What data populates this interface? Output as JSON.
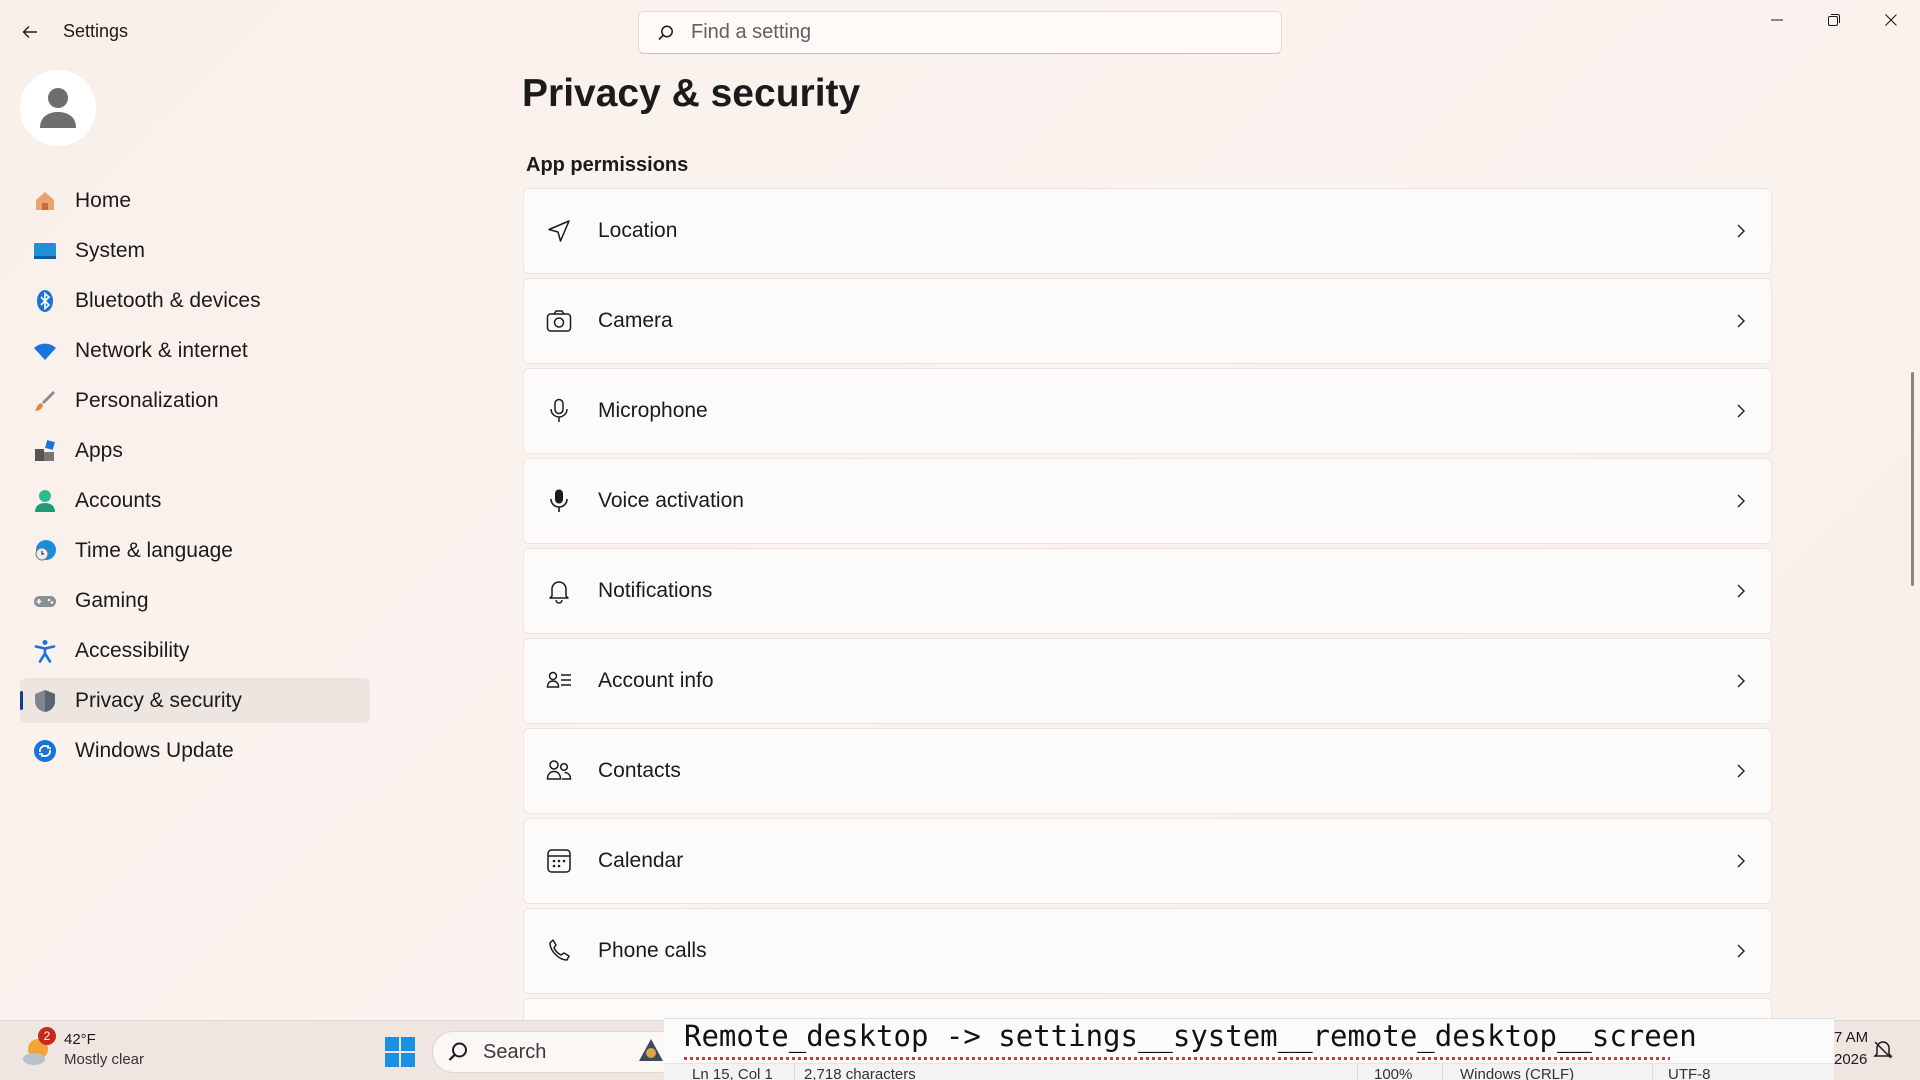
{
  "window": {
    "app_title": "Settings",
    "search_placeholder": "Find a setting"
  },
  "sidebar": {
    "items": [
      {
        "label": "Home",
        "icon": "home-icon"
      },
      {
        "label": "System",
        "icon": "system-icon"
      },
      {
        "label": "Bluetooth & devices",
        "icon": "bluetooth-icon"
      },
      {
        "label": "Network & internet",
        "icon": "wifi-icon"
      },
      {
        "label": "Personalization",
        "icon": "brush-icon"
      },
      {
        "label": "Apps",
        "icon": "apps-icon"
      },
      {
        "label": "Accounts",
        "icon": "person-icon"
      },
      {
        "label": "Time & language",
        "icon": "globe-clock-icon"
      },
      {
        "label": "Gaming",
        "icon": "gamepad-icon"
      },
      {
        "label": "Accessibility",
        "icon": "accessibility-icon"
      },
      {
        "label": "Privacy & security",
        "icon": "shield-icon",
        "active": true
      },
      {
        "label": "Windows Update",
        "icon": "update-icon"
      }
    ]
  },
  "main": {
    "page_title": "Privacy & security",
    "section_title": "App permissions",
    "permissions": [
      {
        "label": "Location",
        "icon": "location-icon"
      },
      {
        "label": "Camera",
        "icon": "camera-icon"
      },
      {
        "label": "Microphone",
        "icon": "microphone-icon"
      },
      {
        "label": "Voice activation",
        "icon": "voice-activation-icon"
      },
      {
        "label": "Notifications",
        "icon": "bell-icon"
      },
      {
        "label": "Account info",
        "icon": "account-info-icon"
      },
      {
        "label": "Contacts",
        "icon": "contacts-icon"
      },
      {
        "label": "Calendar",
        "icon": "calendar-icon"
      },
      {
        "label": "Phone calls",
        "icon": "phone-icon"
      }
    ]
  },
  "taskbar": {
    "weather_badge": "2",
    "weather_temp": "42°F",
    "weather_desc": "Mostly clear",
    "search_label": "Search",
    "clock_time": "7 AM",
    "clock_date": "2026"
  },
  "notepad": {
    "line1": "Remote_desktop -> settings__system__remote_desktop__screen",
    "line2": "",
    "status_position": "Ln 15, Col 1",
    "status_chars": "2,718 characters",
    "status_zoom": "100%",
    "status_eol": "Windows (CRLF)",
    "status_encoding": "UTF-8"
  },
  "colors": {
    "accent": "#0f3e8c",
    "background": "#f9f1ec",
    "card": "#fdfbfa"
  }
}
